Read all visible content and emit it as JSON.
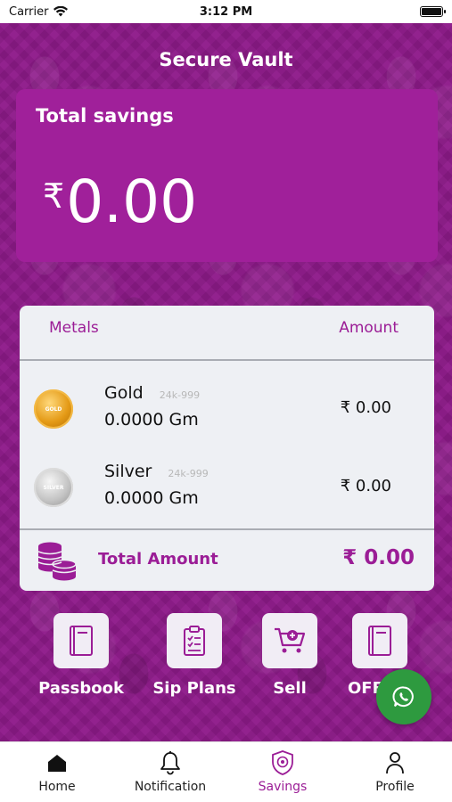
{
  "status_bar": {
    "carrier": "Carrier",
    "time": "3:12 PM"
  },
  "header": {
    "title": "Secure Vault"
  },
  "savings": {
    "title": "Total savings",
    "currency_symbol": "₹",
    "amount": "0.00"
  },
  "metals": {
    "col_left": "Metals",
    "col_right": "Amount",
    "items": [
      {
        "name": "Gold",
        "purity": "24k-999",
        "qty": "0.0000 Gm",
        "amount": "₹ 0.00",
        "coin_text": "GOLD"
      },
      {
        "name": "Silver",
        "purity": "24k-999",
        "qty": "0.0000 Gm",
        "amount": "₹ 0.00",
        "coin_text": "SILVER"
      }
    ],
    "total_label": "Total Amount",
    "total_value": "₹ 0.00"
  },
  "quick_actions": [
    {
      "label": "Passbook",
      "icon": "book-icon"
    },
    {
      "label": "Sip Plans",
      "icon": "clipboard-icon"
    },
    {
      "label": "Sell",
      "icon": "cart-icon"
    },
    {
      "label": "OFF",
      "icon": "book-icon"
    }
  ],
  "bottom_nav": [
    {
      "label": "Home",
      "icon": "home-icon"
    },
    {
      "label": "Notification",
      "icon": "bell-icon"
    },
    {
      "label": "Savings",
      "icon": "shield-icon",
      "active": true
    },
    {
      "label": "Profile",
      "icon": "person-icon"
    }
  ],
  "colors": {
    "primary": "#9b1d96",
    "card_purple": "#a0209a",
    "whatsapp": "#2e9a3f"
  }
}
